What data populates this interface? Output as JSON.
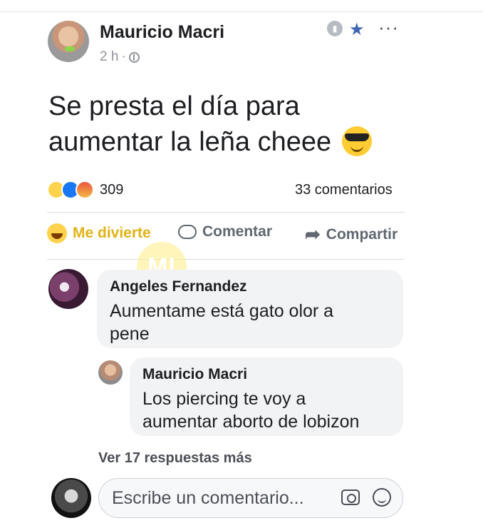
{
  "post": {
    "author": "Mauricio Macri",
    "time": "2 h",
    "separator": "·",
    "text_line1": "Se presta el día para",
    "text_line2": "aumentar la leña cheee",
    "icons": {
      "stats": "stats-icon",
      "star": "star-icon",
      "more": "more-icon",
      "privacy": "globe-icon",
      "emoji": "sunglasses-emoji"
    }
  },
  "reactions": {
    "types": [
      "haha",
      "like",
      "angry"
    ],
    "count": "309",
    "comments": "33 comentarios"
  },
  "actions": {
    "react": "Me divierte",
    "comment": "Comentar",
    "share": "Compartir"
  },
  "comments": [
    {
      "author": "Angeles Fernandez",
      "line1": "Aumentame está gato olor a",
      "line2": "pene"
    }
  ],
  "replies": [
    {
      "author": "Mauricio Macri",
      "line1": "Los piercing te voy a",
      "line2": "aumentar aborto de lobizon"
    }
  ],
  "more_replies": "Ver 17 respuestas más",
  "composer": {
    "placeholder": "Escribe un comentario..."
  },
  "colors": {
    "accent": "#4267b2",
    "reaction": "#e1b317",
    "bubble": "#f2f3f5"
  }
}
